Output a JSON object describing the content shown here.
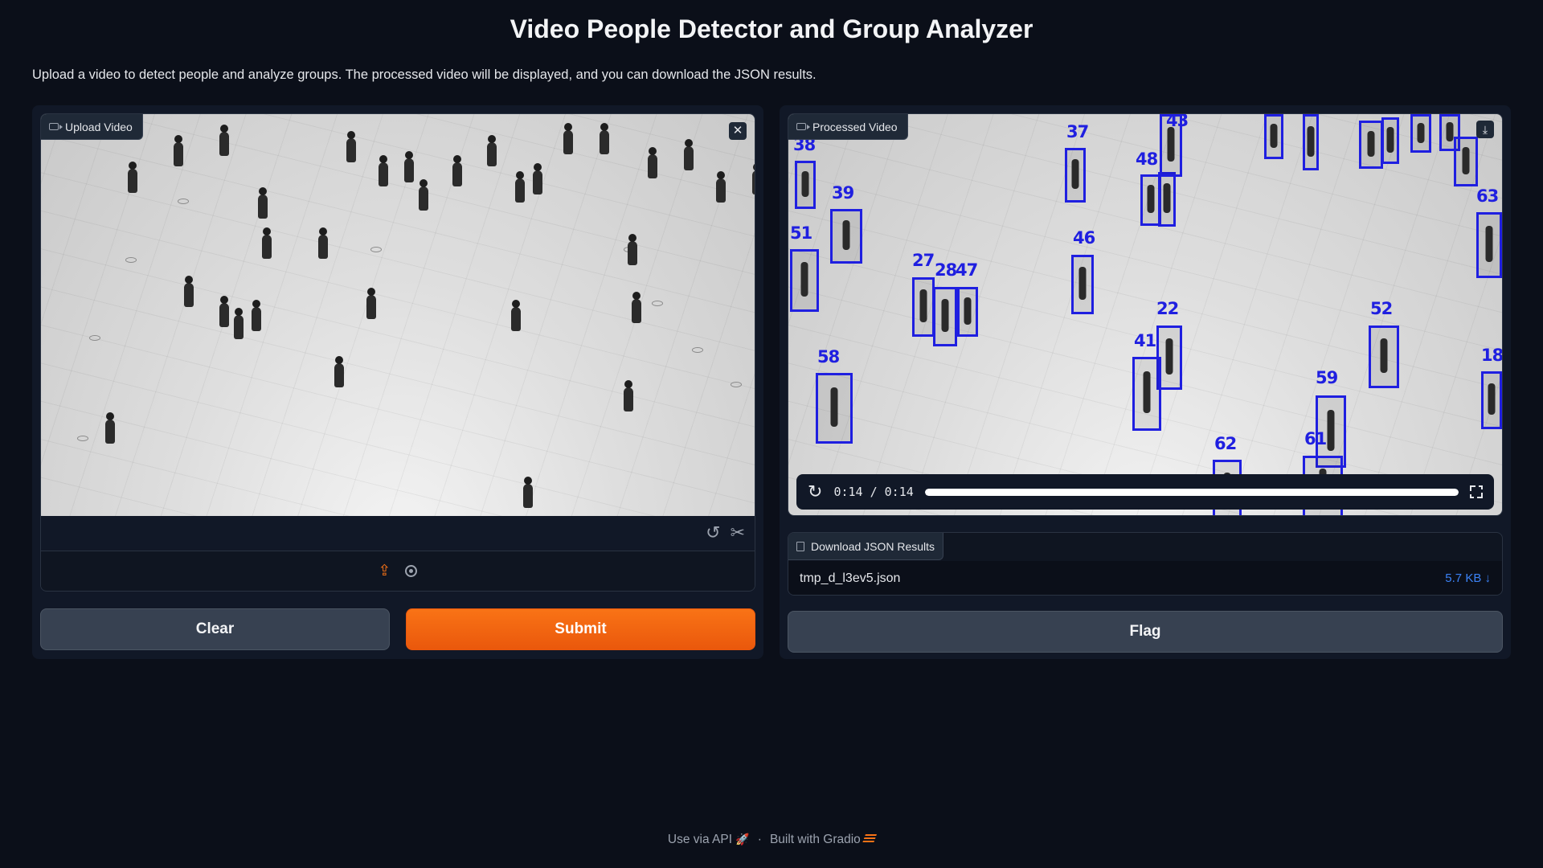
{
  "header": {
    "title": "Video People Detector and Group Analyzer",
    "description": "Upload a video to detect people and analyze groups. The processed video will be displayed, and you can download the JSON results."
  },
  "input_panel": {
    "label": "Upload Video",
    "clear_label": "Clear",
    "submit_label": "Submit"
  },
  "output_panel": {
    "label": "Processed Video",
    "time_display": "0:14 / 0:14",
    "progress_fraction": 1.0,
    "detection_ids": [
      "38",
      "39",
      "51",
      "27",
      "28",
      "47",
      "37",
      "46",
      "48",
      "43",
      "22",
      "41",
      "52",
      "59",
      "58",
      "62",
      "61",
      "63",
      "18"
    ],
    "download_label": "Download JSON Results",
    "file_name": "tmp_d_l3ev5.json",
    "file_size": "5.7 KB",
    "flag_label": "Flag"
  },
  "footer": {
    "api_label": "Use via API",
    "separator": "·",
    "built_with": "Built with Gradio"
  },
  "colors": {
    "background": "#0b0f19",
    "panel": "#111827",
    "accent": "#f97316",
    "detection_box": "#1f1fe0",
    "link": "#3b82f6"
  }
}
